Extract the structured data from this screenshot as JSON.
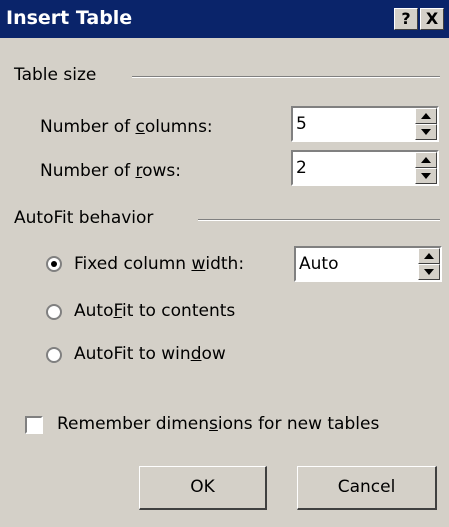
{
  "window": {
    "title": "Insert Table",
    "help_label": "?",
    "close_label": "X"
  },
  "table_size": {
    "group_label": "Table size",
    "columns": {
      "label_pre": "Number of ",
      "label_key": "c",
      "label_post": "olumns:",
      "value": "5"
    },
    "rows": {
      "label_pre": "Number of ",
      "label_key": "r",
      "label_post": "ows:",
      "value": "2"
    }
  },
  "autofit": {
    "group_label": "AutoFit behavior",
    "fixed": {
      "label_pre": "Fixed column ",
      "label_key": "w",
      "label_post": "idth:",
      "selected": true,
      "value": "Auto"
    },
    "contents": {
      "label_pre": "Auto",
      "label_key": "F",
      "label_post": "it to contents",
      "selected": false
    },
    "window": {
      "label_pre": "AutoFit to win",
      "label_key": "d",
      "label_post": "ow",
      "selected": false
    }
  },
  "remember": {
    "label_pre": "Remember dimen",
    "label_key": "s",
    "label_post": "ions for new tables",
    "checked": false
  },
  "buttons": {
    "ok": "OK",
    "cancel": "Cancel"
  },
  "icons": {
    "help": "help-icon",
    "close": "close-icon",
    "spin_up": "spin-up-icon",
    "spin_down": "spin-down-icon"
  },
  "colors": {
    "titlebar": "#0a246a",
    "face": "#d4d0c8"
  }
}
